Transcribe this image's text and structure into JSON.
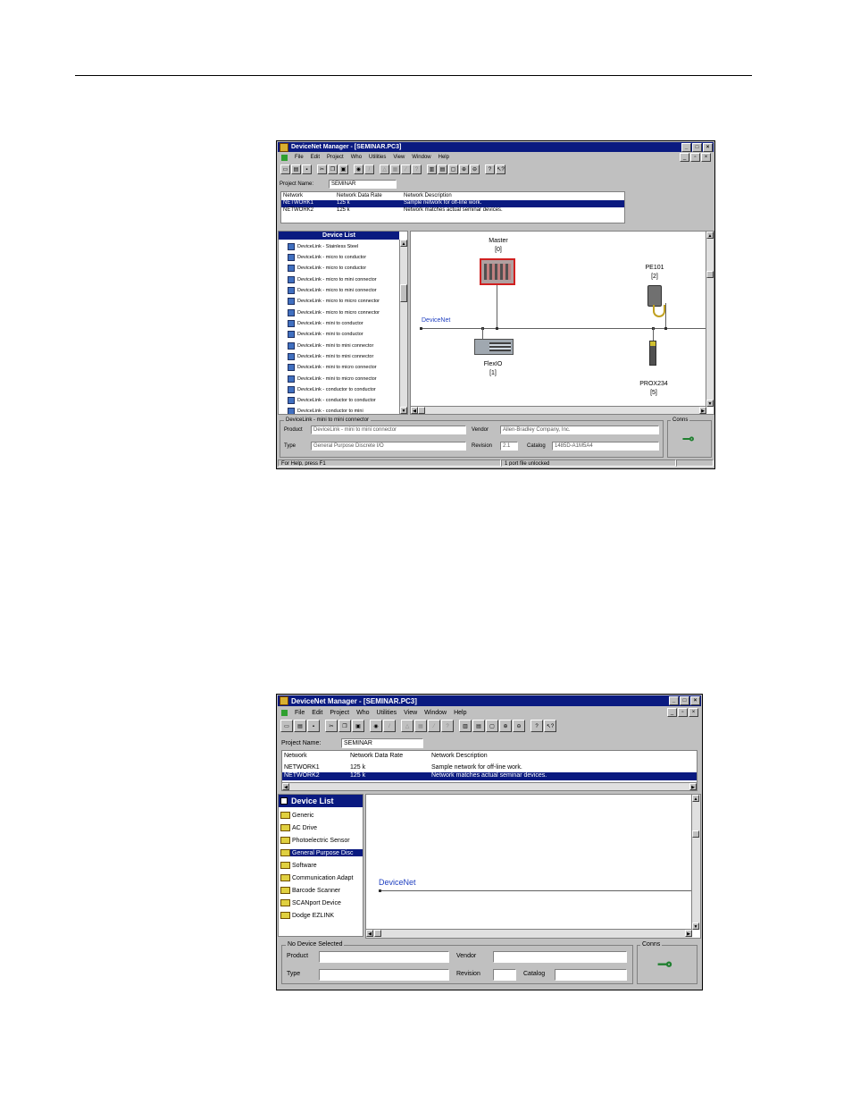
{
  "window1": {
    "title": "DeviceNet Manager - [SEMINAR.PC3]",
    "menu": [
      "File",
      "Edit",
      "Project",
      "Who",
      "Utilities",
      "View",
      "Window",
      "Help"
    ],
    "project_name_label": "Project Name:",
    "project_name_value": "SEMINAR",
    "network_columns": [
      "Network",
      "Network Data Rate",
      "Network Description"
    ],
    "networks": [
      {
        "name": "NETWORK1",
        "rate": "125 k",
        "desc": "Sample network for off-line work."
      },
      {
        "name": "NETWORK2",
        "rate": "125 k",
        "desc": "Network matches actual seminar devices."
      }
    ],
    "device_list_title": "Device List",
    "device_list": [
      "DeviceLink - Stainless Steel",
      "DeviceLink - micro to conductor",
      "DeviceLink - micro to conductor",
      "DeviceLink - micro to mini connector",
      "DeviceLink - micro to mini connector",
      "DeviceLink - micro to micro connector",
      "DeviceLink - micro to micro connector",
      "DeviceLink - mini to conductor",
      "DeviceLink - mini to conductor",
      "DeviceLink - mini to mini connector",
      "DeviceLink - mini to mini connector",
      "DeviceLink - mini to micro connector",
      "DeviceLink - mini to micro connector",
      "DeviceLink - conductor to conductor",
      "DeviceLink - conductor to conductor",
      "DeviceLink - conductor to mini"
    ],
    "network_label": "DeviceNet",
    "devices": {
      "master": {
        "name": "Master",
        "addr": "[0]"
      },
      "pe101": {
        "name": "PE101",
        "addr": "[2]"
      },
      "flexio": {
        "name": "FlexIO",
        "addr": "[1]"
      },
      "prox234": {
        "name": "PROX234",
        "addr": "[5]"
      }
    },
    "selected_title": "DeviceLink - mini to mini connector",
    "product_label": "Product",
    "product_value": "DeviceLink - mini to mini connector",
    "vendor_label": "Vendor",
    "vendor_value": "Allen-Bradley Company, Inc.",
    "type_label": "Type",
    "type_value": "General Purpose Discrete I/O",
    "revision_label": "Revision",
    "revision_value": "2.1",
    "catalog_label": "Catalog",
    "catalog_value": "1485D-A1M5A4",
    "conn_label": "Conns",
    "status_left": "For Help, press F1",
    "status_mid": "1 port file unlocked"
  },
  "window2": {
    "title": "DeviceNet Manager - [SEMINAR.PC3]",
    "menu": [
      "File",
      "Edit",
      "Project",
      "Who",
      "Utilities",
      "View",
      "Window",
      "Help"
    ],
    "project_name_label": "Project Name:",
    "project_name_value": "SEMINAR",
    "network_columns": [
      "Network",
      "Network Data Rate",
      "Network Description"
    ],
    "networks": [
      {
        "name": "NETWORK1",
        "rate": "125 k",
        "desc": "Sample network for off-line work."
      },
      {
        "name": "NETWORK2",
        "rate": "125 k",
        "desc": "Network matches actual seminar devices."
      }
    ],
    "device_list_title": "Device List",
    "device_list": [
      "Generic",
      "AC Drive",
      "Photoelectric Sensor",
      "General Purpose Disc",
      "Software",
      "Communication Adapt",
      "Barcode Scanner",
      "SCANport Device",
      "Dodge EZLINK"
    ],
    "network_label": "DeviceNet",
    "selected_title": "No Device Selected",
    "product_label": "Product",
    "vendor_label": "Vendor",
    "type_label": "Type",
    "revision_label": "Revision",
    "catalog_label": "Catalog",
    "conn_label": "Conns"
  }
}
